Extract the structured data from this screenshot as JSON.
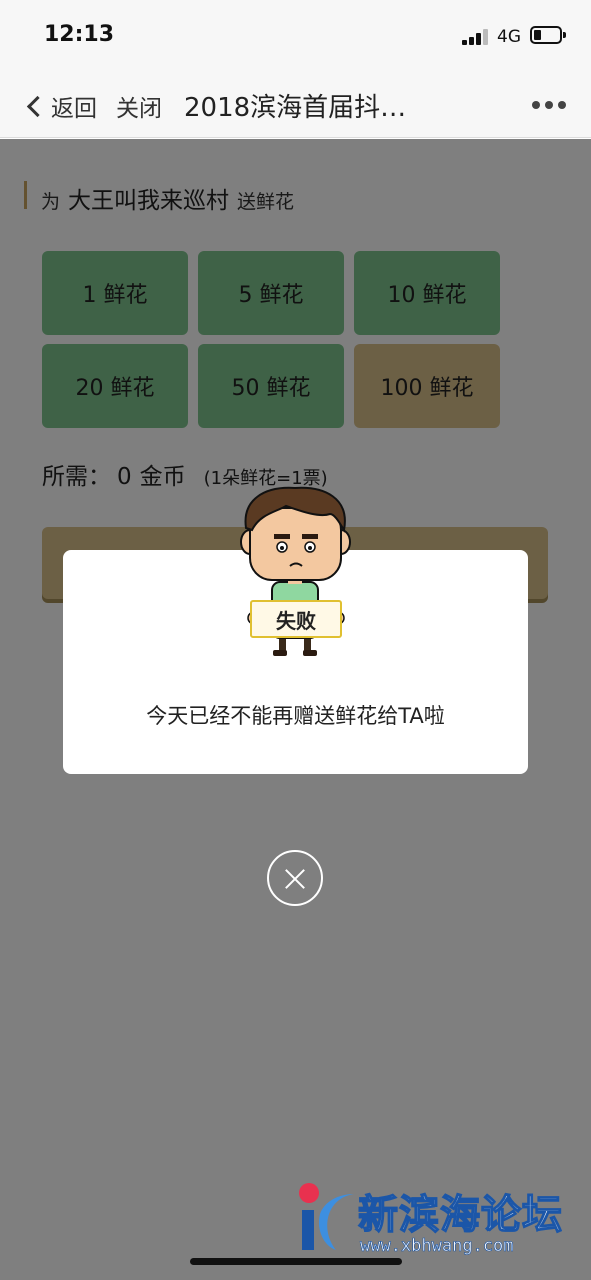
{
  "status_bar": {
    "time": "12:13",
    "network": "4G"
  },
  "nav": {
    "back_label": "返回",
    "close_label": "关闭",
    "title": "2018滨海首届抖…"
  },
  "recipient": {
    "prefix": "为",
    "name": "大王叫我来巡村",
    "suffix": "送鲜花"
  },
  "options": [
    {
      "label": "1 鲜花"
    },
    {
      "label": "5 鲜花"
    },
    {
      "label": "10 鲜花"
    },
    {
      "label": "20 鲜花"
    },
    {
      "label": "50 鲜花"
    },
    {
      "label": "100 鲜花",
      "selected": true
    }
  ],
  "cost": {
    "label": "所需：",
    "value": "0",
    "unit": "金币",
    "note": "(1朵鲜花=1票)"
  },
  "dialog": {
    "sign_text": "失败",
    "message": "今天已经不能再赠送鲜花给TA啦"
  },
  "watermark": {
    "name": "新滨海论坛",
    "url": "www.xbhwang.com"
  },
  "colors": {
    "option_green": "#7fc58f",
    "option_selected": "#d8c08a",
    "mask": "#000000"
  }
}
